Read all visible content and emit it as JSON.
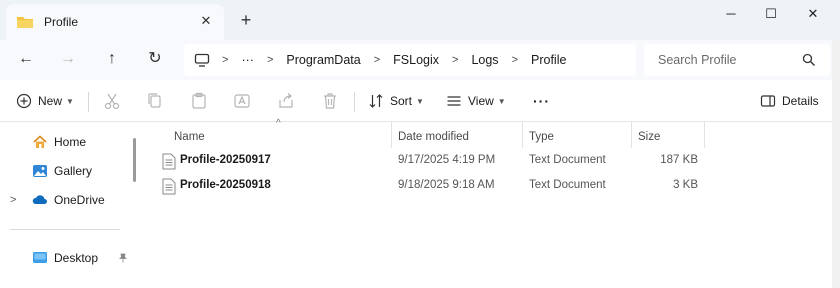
{
  "window": {
    "tab_title": "Profile",
    "tab_close_symbol": "✕",
    "new_tab_symbol": "+",
    "minimize_symbol": "─",
    "maximize_symbol": "☐",
    "close_symbol": "✕"
  },
  "addressbar": {
    "back_symbol": "←",
    "forward_symbol": "→",
    "up_symbol": "↑",
    "refresh_symbol": "↻",
    "ellipsis": "···",
    "breadcrumbs": [
      "ProgramData",
      "FSLogix",
      "Logs",
      "Profile"
    ],
    "search_placeholder": "Search Profile"
  },
  "commandbar": {
    "new_label": "New",
    "sort_label": "Sort",
    "view_label": "View",
    "more_symbol": "···",
    "details_label": "Details"
  },
  "navpane": {
    "items": [
      {
        "label": "Home",
        "icon": "home-icon"
      },
      {
        "label": "Gallery",
        "icon": "gallery-icon"
      },
      {
        "label": "OneDrive",
        "icon": "onedrive-icon"
      },
      {
        "label": "Desktop",
        "icon": "desktop-icon"
      }
    ]
  },
  "filelist": {
    "columns": {
      "name": "Name",
      "date": "Date modified",
      "type": "Type",
      "size": "Size"
    },
    "rows": [
      {
        "name": "Profile-20250917",
        "date": "9/17/2025 4:19 PM",
        "type": "Text Document",
        "size": "187 KB"
      },
      {
        "name": "Profile-20250918",
        "date": "9/18/2025 9:18 AM",
        "type": "Text Document",
        "size": "3 KB"
      }
    ]
  },
  "colors": {
    "accent": "#0067c0",
    "folder": "#f4c33d",
    "chrome": "#eef3f8"
  }
}
